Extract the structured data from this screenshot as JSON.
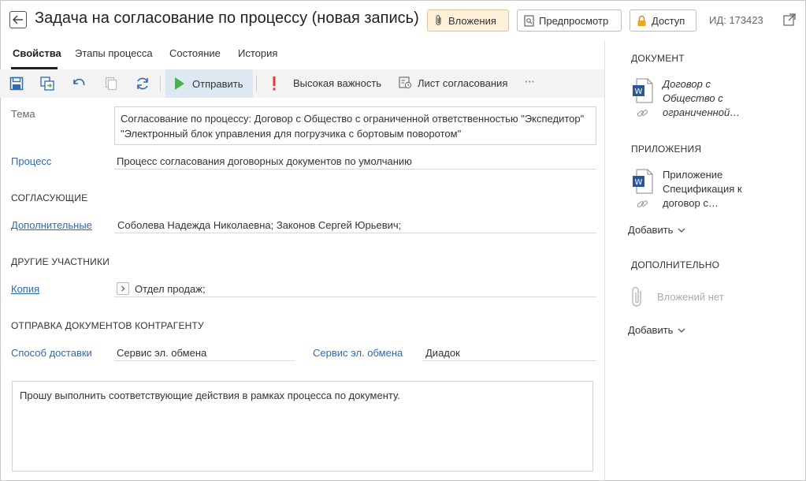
{
  "header": {
    "title": "Задача на согласование по процессу (новая запись)",
    "attachments_label": "Вложения",
    "preview_label": "Предпросмотр",
    "access_label": "Доступ",
    "id_label": "ИД: 173423"
  },
  "tabs": [
    {
      "label": "Свойства",
      "active": true
    },
    {
      "label": "Этапы процесса",
      "active": false
    },
    {
      "label": "Состояние",
      "active": false
    },
    {
      "label": "История",
      "active": false
    }
  ],
  "toolbar": {
    "send_label": "Отправить",
    "importance_label": "Высокая важность",
    "approval_sheet_label": "Лист согласования",
    "more_label": "···"
  },
  "form": {
    "subject_label": "Тема",
    "subject_value": "Согласование по процессу: Договор с Общество с ограниченной ответственностью \"Экспедитор\" \"Электронный блок управления для погрузчика с бортовым поворотом\"",
    "process_label": "Процесс",
    "process_value": "Процесс согласования договорных документов по умолчанию",
    "approvers_section": "СОГЛАСУЮЩИЕ",
    "additional_label": "Дополнительные",
    "additional_value": "Соболева Надежда Николаевна; Законов Сергей Юрьевич;",
    "other_section": "ДРУГИЕ УЧАСТНИКИ",
    "copy_label": "Копия",
    "copy_value": "Отдел продаж;",
    "counterparty_section": "ОТПРАВКА ДОКУМЕНТОВ КОНТРАГЕНТУ",
    "delivery_label": "Способ доставки",
    "delivery_value": "Сервис эл. обмена",
    "exchange_label": "Сервис эл. обмена",
    "exchange_value": "Диадок",
    "message": "Прошу выполнить соответствующие действия в рамках процесса по документу."
  },
  "right_panel": {
    "document_section": "ДОКУМЕНТ",
    "document_title": "Договор с Общество с ограниченной…",
    "attachments_section": "ПРИЛОЖЕНИЯ",
    "attachment_title": "Приложение Спецификация к договор с…",
    "add_label": "Добавить",
    "additional_section": "ДОПОЛНИТЕЛЬНО",
    "no_attachments": "Вложений нет",
    "add_label_2": "Добавить"
  },
  "colors": {
    "link": "#2e6ab1",
    "send_green": "#4caf50",
    "importance_red": "#e53935",
    "word_blue": "#2b5797",
    "attach_bg": "#fdf2d9"
  }
}
